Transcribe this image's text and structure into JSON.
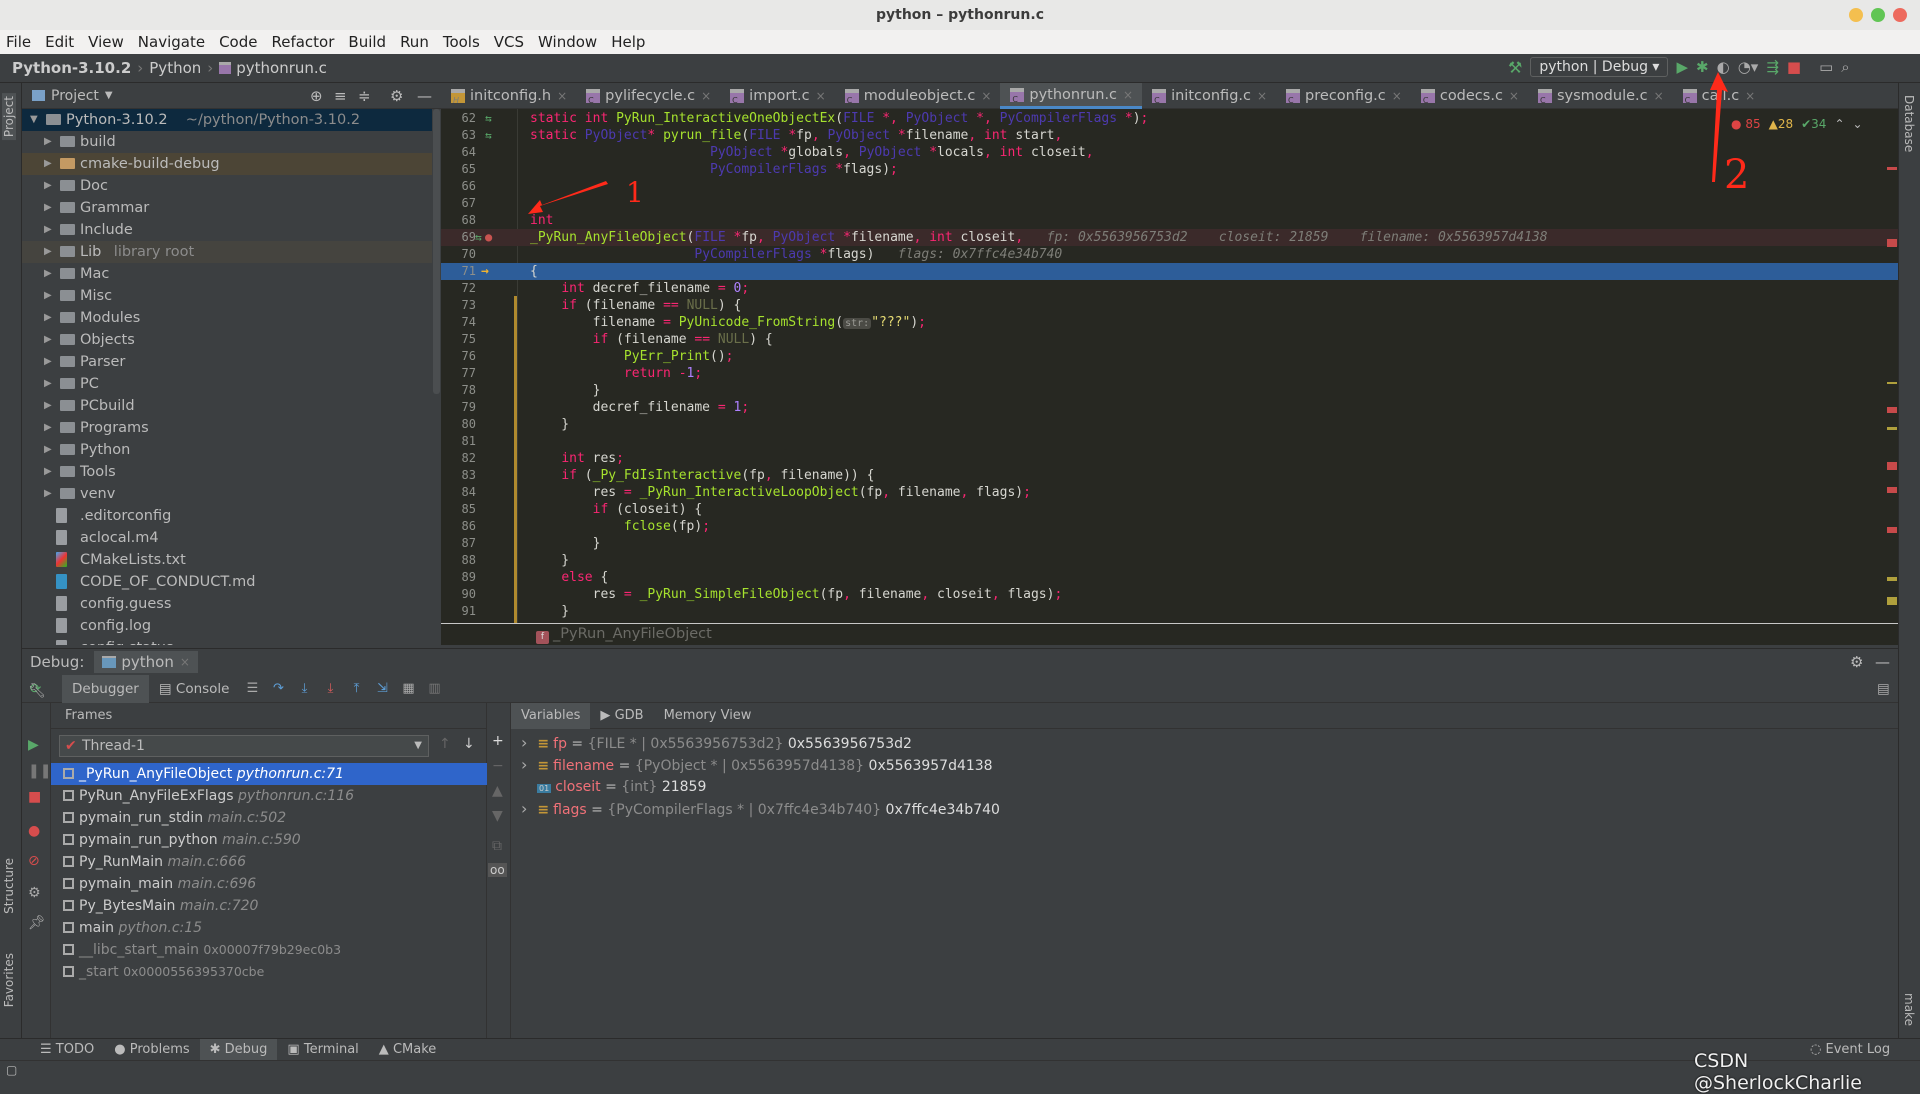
{
  "window": {
    "title": "python – pythonrun.c"
  },
  "menu": [
    "File",
    "Edit",
    "View",
    "Navigate",
    "Code",
    "Refactor",
    "Build",
    "Run",
    "Tools",
    "VCS",
    "Window",
    "Help"
  ],
  "breadcrumb": [
    "Python-3.10.2",
    "Python",
    "pythonrun.c"
  ],
  "run_config": {
    "label": "python | Debug"
  },
  "inspections": {
    "errors": "85",
    "warnings": "28",
    "ok": "34"
  },
  "project_panel": {
    "title": "Project"
  },
  "tree": [
    {
      "label": "Python-3.10.2",
      "suffix": "~/python/Python-3.10.2",
      "level": 0,
      "type": "folder",
      "expanded": true,
      "state": "selected"
    },
    {
      "label": "build",
      "level": 1,
      "type": "folder"
    },
    {
      "label": "cmake-build-debug",
      "level": 1,
      "type": "folder-orange",
      "state": "highlight"
    },
    {
      "label": "Doc",
      "level": 1,
      "type": "folder"
    },
    {
      "label": "Grammar",
      "level": 1,
      "type": "folder"
    },
    {
      "label": "Include",
      "level": 1,
      "type": "folder"
    },
    {
      "label": "Lib",
      "suffix": "library root",
      "level": 1,
      "type": "folder",
      "state": "library"
    },
    {
      "label": "Mac",
      "level": 1,
      "type": "folder"
    },
    {
      "label": "Misc",
      "level": 1,
      "type": "folder"
    },
    {
      "label": "Modules",
      "level": 1,
      "type": "folder"
    },
    {
      "label": "Objects",
      "level": 1,
      "type": "folder"
    },
    {
      "label": "Parser",
      "level": 1,
      "type": "folder"
    },
    {
      "label": "PC",
      "level": 1,
      "type": "folder"
    },
    {
      "label": "PCbuild",
      "level": 1,
      "type": "folder"
    },
    {
      "label": "Programs",
      "level": 1,
      "type": "folder"
    },
    {
      "label": "Python",
      "level": 1,
      "type": "folder"
    },
    {
      "label": "Tools",
      "level": 1,
      "type": "folder"
    },
    {
      "label": "venv",
      "level": 1,
      "type": "folder"
    },
    {
      "label": ".editorconfig",
      "level": 1,
      "type": "file"
    },
    {
      "label": "aclocal.m4",
      "level": 1,
      "type": "file"
    },
    {
      "label": "CMakeLists.txt",
      "level": 1,
      "type": "cmake"
    },
    {
      "label": "CODE_OF_CONDUCT.md",
      "level": 1,
      "type": "md"
    },
    {
      "label": "config.guess",
      "level": 1,
      "type": "script"
    },
    {
      "label": "config.log",
      "level": 1,
      "type": "file"
    },
    {
      "label": "config.status",
      "level": 1,
      "type": "file"
    }
  ],
  "tabs": [
    {
      "label": "initconfig.h",
      "kind": "h"
    },
    {
      "label": "pylifecycle.c",
      "kind": "c"
    },
    {
      "label": "import.c",
      "kind": "c"
    },
    {
      "label": "moduleobject.c",
      "kind": "c"
    },
    {
      "label": "pythonrun.c",
      "kind": "c",
      "active": true
    },
    {
      "label": "initconfig.c",
      "kind": "c"
    },
    {
      "label": "preconfig.c",
      "kind": "c"
    },
    {
      "label": "codecs.c",
      "kind": "c"
    },
    {
      "label": "sysmodule.c",
      "kind": "c"
    },
    {
      "label": "call.c",
      "kind": "c"
    }
  ],
  "code": [
    {
      "n": "62",
      "tokens": [
        [
          "k",
          "static "
        ],
        [
          "k",
          "int "
        ],
        [
          "f",
          "PyRun_InteractiveOneObjectEx"
        ],
        [
          "d",
          "("
        ],
        [
          "t",
          "FILE "
        ],
        [
          "k",
          "*, "
        ],
        [
          "t",
          "PyObject "
        ],
        [
          "k",
          "*, "
        ],
        [
          "t",
          "PyCompilerFlags "
        ],
        [
          "k",
          "*"
        ],
        [
          "d",
          ")"
        ],
        [
          "k",
          ";"
        ]
      ]
    },
    {
      "n": "63",
      "tokens": [
        [
          "k",
          "static "
        ],
        [
          "t",
          "PyObject"
        ],
        [
          "k",
          "* "
        ],
        [
          "f",
          "pyrun_file"
        ],
        [
          "d",
          "("
        ],
        [
          "t",
          "FILE "
        ],
        [
          "k",
          "*"
        ],
        [
          "d",
          "fp"
        ],
        [
          "k",
          ", "
        ],
        [
          "t",
          "PyObject "
        ],
        [
          "k",
          "*"
        ],
        [
          "d",
          "filename"
        ],
        [
          "k",
          ", int "
        ],
        [
          "d",
          "start"
        ],
        [
          "k",
          ","
        ]
      ]
    },
    {
      "n": "64",
      "tokens": [
        [
          "d",
          "                       "
        ],
        [
          "t",
          "PyObject "
        ],
        [
          "k",
          "*"
        ],
        [
          "d",
          "globals"
        ],
        [
          "k",
          ", "
        ],
        [
          "t",
          "PyObject "
        ],
        [
          "k",
          "*"
        ],
        [
          "d",
          "locals"
        ],
        [
          "k",
          ", int "
        ],
        [
          "d",
          "closeit"
        ],
        [
          "k",
          ","
        ]
      ]
    },
    {
      "n": "65",
      "tokens": [
        [
          "d",
          "                       "
        ],
        [
          "t",
          "PyCompilerFlags "
        ],
        [
          "k",
          "*"
        ],
        [
          "d",
          "flags)"
        ],
        [
          "k",
          ";"
        ]
      ]
    },
    {
      "n": "66",
      "tokens": []
    },
    {
      "n": "67",
      "tokens": []
    },
    {
      "n": "68",
      "tokens": [
        [
          "k",
          "int"
        ]
      ]
    },
    {
      "n": "69",
      "state": "breakpoint",
      "tokens": [
        [
          "f",
          "_PyRun_AnyFileObject"
        ],
        [
          "d",
          "("
        ],
        [
          "t",
          "FILE "
        ],
        [
          "k",
          "*"
        ],
        [
          "d",
          "fp"
        ],
        [
          "k",
          ", "
        ],
        [
          "t",
          "PyObject "
        ],
        [
          "k",
          "*"
        ],
        [
          "d",
          "filename"
        ],
        [
          "k",
          ", int "
        ],
        [
          "d",
          "closeit"
        ],
        [
          "k",
          ",   "
        ],
        [
          "h",
          "fp: 0x5563956753d2    closeit: 21859    filename: 0x5563957d4138"
        ]
      ]
    },
    {
      "n": "70",
      "tokens": [
        [
          "d",
          "                     "
        ],
        [
          "t",
          "PyCompilerFlags "
        ],
        [
          "k",
          "*"
        ],
        [
          "d",
          "flags)   "
        ],
        [
          "h",
          "flags: 0x7ffc4e34b740"
        ]
      ]
    },
    {
      "n": "71",
      "state": "current",
      "tokens": [
        [
          "d",
          "{"
        ]
      ]
    },
    {
      "n": "72",
      "tokens": [
        [
          "d",
          "    "
        ],
        [
          "k",
          "int "
        ],
        [
          "d",
          "decref_filename "
        ],
        [
          "k",
          "= "
        ],
        [
          "n",
          "0"
        ],
        [
          "k",
          ";"
        ]
      ]
    },
    {
      "n": "73",
      "tokens": [
        [
          "d",
          "    "
        ],
        [
          "k",
          "if "
        ],
        [
          "d",
          "(filename "
        ],
        [
          "k",
          "== "
        ],
        [
          "nu",
          "NULL"
        ],
        [
          "d",
          ") {"
        ]
      ]
    },
    {
      "n": "74",
      "tokens": [
        [
          "d",
          "        filename "
        ],
        [
          "k",
          "= "
        ],
        [
          "f",
          "PyUnicode_FromString"
        ],
        [
          "d",
          "("
        ],
        [
          "hint",
          "str:"
        ],
        [
          "s",
          "\"???\""
        ],
        [
          "d",
          ")"
        ],
        [
          "k",
          ";"
        ]
      ]
    },
    {
      "n": "75",
      "tokens": [
        [
          "d",
          "        "
        ],
        [
          "k",
          "if "
        ],
        [
          "d",
          "(filename "
        ],
        [
          "k",
          "== "
        ],
        [
          "nu",
          "NULL"
        ],
        [
          "d",
          ") {"
        ]
      ]
    },
    {
      "n": "76",
      "tokens": [
        [
          "d",
          "            "
        ],
        [
          "f",
          "PyErr_Print"
        ],
        [
          "d",
          "()"
        ],
        [
          "k",
          ";"
        ]
      ]
    },
    {
      "n": "77",
      "tokens": [
        [
          "d",
          "            "
        ],
        [
          "k",
          "return -"
        ],
        [
          "n",
          "1"
        ],
        [
          "k",
          ";"
        ]
      ]
    },
    {
      "n": "78",
      "tokens": [
        [
          "d",
          "        }"
        ]
      ]
    },
    {
      "n": "79",
      "tokens": [
        [
          "d",
          "        decref_filename "
        ],
        [
          "k",
          "= "
        ],
        [
          "n",
          "1"
        ],
        [
          "k",
          ";"
        ]
      ]
    },
    {
      "n": "80",
      "tokens": [
        [
          "d",
          "    }"
        ]
      ]
    },
    {
      "n": "81",
      "tokens": []
    },
    {
      "n": "82",
      "tokens": [
        [
          "d",
          "    "
        ],
        [
          "k",
          "int "
        ],
        [
          "d",
          "res"
        ],
        [
          "k",
          ";"
        ]
      ]
    },
    {
      "n": "83",
      "tokens": [
        [
          "d",
          "    "
        ],
        [
          "k",
          "if "
        ],
        [
          "d",
          "("
        ],
        [
          "f",
          "_Py_FdIsInteractive"
        ],
        [
          "d",
          "(fp"
        ],
        [
          "k",
          ", "
        ],
        [
          "d",
          "filename)) {"
        ]
      ]
    },
    {
      "n": "84",
      "tokens": [
        [
          "d",
          "        res "
        ],
        [
          "k",
          "= "
        ],
        [
          "f",
          "_PyRun_InteractiveLoopObject"
        ],
        [
          "d",
          "(fp"
        ],
        [
          "k",
          ", "
        ],
        [
          "d",
          "filename"
        ],
        [
          "k",
          ", "
        ],
        [
          "d",
          "flags)"
        ],
        [
          "k",
          ";"
        ]
      ]
    },
    {
      "n": "85",
      "tokens": [
        [
          "d",
          "        "
        ],
        [
          "k",
          "if "
        ],
        [
          "d",
          "(closeit) {"
        ]
      ]
    },
    {
      "n": "86",
      "tokens": [
        [
          "d",
          "            "
        ],
        [
          "f",
          "fclose"
        ],
        [
          "d",
          "(fp)"
        ],
        [
          "k",
          ";"
        ]
      ]
    },
    {
      "n": "87",
      "tokens": [
        [
          "d",
          "        }"
        ]
      ]
    },
    {
      "n": "88",
      "tokens": [
        [
          "d",
          "    }"
        ]
      ]
    },
    {
      "n": "89",
      "tokens": [
        [
          "d",
          "    "
        ],
        [
          "k",
          "else "
        ],
        [
          "d",
          "{"
        ]
      ]
    },
    {
      "n": "90",
      "tokens": [
        [
          "d",
          "        res "
        ],
        [
          "k",
          "= "
        ],
        [
          "f",
          "_PyRun_SimpleFileObject"
        ],
        [
          "d",
          "(fp"
        ],
        [
          "k",
          ", "
        ],
        [
          "d",
          "filename"
        ],
        [
          "k",
          ", "
        ],
        [
          "d",
          "closeit"
        ],
        [
          "k",
          ", "
        ],
        [
          "d",
          "flags)"
        ],
        [
          "k",
          ";"
        ]
      ]
    },
    {
      "n": "91",
      "tokens": [
        [
          "d",
          "    }"
        ]
      ]
    }
  ],
  "editor_breadcrumb": "_PyRun_AnyFileObject",
  "debug": {
    "label": "Debug:",
    "session": "python",
    "tabs": [
      "Debugger",
      "Console"
    ],
    "frames_title": "Frames",
    "thread": "Thread-1",
    "frames": [
      {
        "name": "_PyRun_AnyFileObject",
        "loc": "pythonrun.c:71",
        "selected": true
      },
      {
        "name": "PyRun_AnyFileExFlags",
        "loc": "pythonrun.c:116"
      },
      {
        "name": "pymain_run_stdin",
        "loc": "main.c:502"
      },
      {
        "name": "pymain_run_python",
        "loc": "main.c:590"
      },
      {
        "name": "Py_RunMain",
        "loc": "main.c:666"
      },
      {
        "name": "pymain_main",
        "loc": "main.c:696"
      },
      {
        "name": "Py_BytesMain",
        "loc": "main.c:720"
      },
      {
        "name": "main",
        "loc": "python.c:15"
      },
      {
        "name": "__libc_start_main",
        "addr": "0x00007f79b29ec0b3",
        "lib": true
      },
      {
        "name": "_start",
        "addr": "0x0000556395370cbe",
        "lib": true
      }
    ],
    "var_tabs": [
      "Variables",
      "GDB",
      "Memory View"
    ],
    "variables": [
      {
        "name": "fp",
        "type": "{FILE * | 0x5563956753d2}",
        "value": "0x5563956753d2",
        "expandable": true
      },
      {
        "name": "filename",
        "type": "{PyObject * | 0x5563957d4138}",
        "value": "0x5563957d4138",
        "expandable": true
      },
      {
        "name": "closeit",
        "type": "{int}",
        "value": "21859",
        "expandable": false
      },
      {
        "name": "flags",
        "type": "{PyCompilerFlags * | 0x7ffc4e34b740}",
        "value": "0x7ffc4e34b740",
        "expandable": true
      }
    ]
  },
  "bottom_tabs": [
    {
      "label": "TODO"
    },
    {
      "label": "Problems"
    },
    {
      "label": "Debug",
      "active": true
    },
    {
      "label": "Terminal"
    },
    {
      "label": "CMake"
    }
  ],
  "event_log": "Event Log",
  "side_labels": {
    "left": [
      "Project",
      "Structure",
      "Favorites"
    ],
    "right": [
      "Database",
      "make"
    ]
  },
  "annotations": [
    "1",
    "2"
  ],
  "watermark": "CSDN @SherlockCharlie",
  "colors": {
    "accent": "#2f65ca",
    "keyword": "#f92672",
    "function": "#a6e22e",
    "breakpoint": "#c75450",
    "annotation": "#ff2a1a"
  }
}
